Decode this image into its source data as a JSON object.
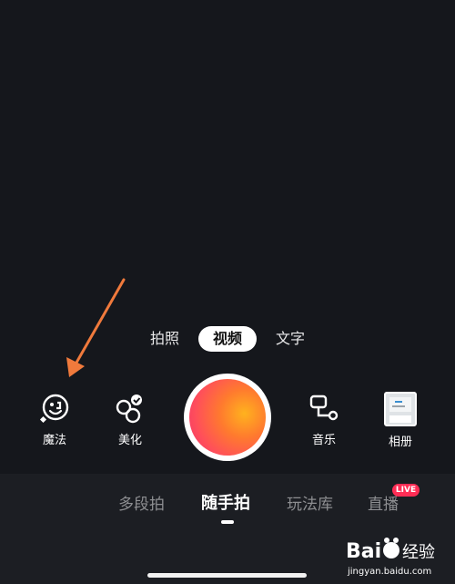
{
  "modes": [
    {
      "label": "拍照",
      "active": false
    },
    {
      "label": "视频",
      "active": true
    },
    {
      "label": "文字",
      "active": false
    }
  ],
  "tools": {
    "magic": {
      "label": "魔法",
      "icon": "magic-face-icon"
    },
    "beauty": {
      "label": "美化",
      "icon": "beauty-icon"
    },
    "music": {
      "label": "音乐",
      "icon": "music-icon"
    },
    "album": {
      "label": "相册",
      "icon": "album-thumbnail"
    }
  },
  "shutter": {
    "gradient": [
      "#ffb21e",
      "#ff4f5a",
      "#f0306e"
    ]
  },
  "tabs": [
    {
      "label": "多段拍",
      "active": false
    },
    {
      "label": "随手拍",
      "active": true
    },
    {
      "label": "玩法库",
      "active": false
    },
    {
      "label": "直播",
      "active": false,
      "badge": "LIVE"
    }
  ],
  "watermark": {
    "brand": "Bai经验",
    "url": "jingyan.baidu.com"
  },
  "colors": {
    "background": "#15171c",
    "tabbar": "#1c1e23",
    "arrow": "#f07a3c",
    "badge": "#ff2d55"
  }
}
